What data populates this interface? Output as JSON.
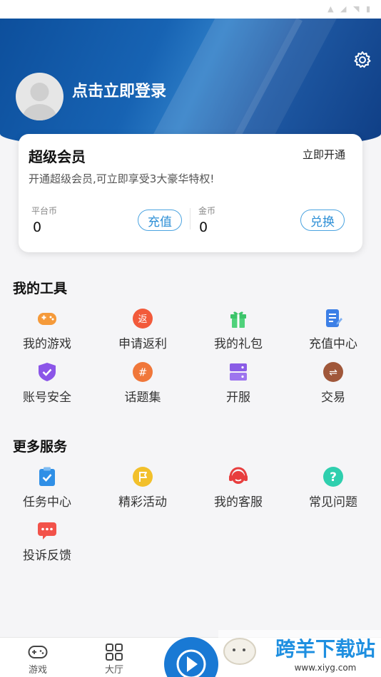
{
  "status_bar": {
    "icons": "▲ ◢ ◥ ▮"
  },
  "header": {
    "login_text": "点击立即登录",
    "settings_icon": "settings-gear-icon",
    "avatar_icon": "default-avatar-icon"
  },
  "vip": {
    "title": "超级会员",
    "open_label": "立即开通",
    "description": "开通超级会员,可立即享受3大豪华特权!",
    "platform_coin_label": "平台币",
    "platform_coin_value": "0",
    "recharge_label": "充值",
    "gold_coin_label": "金币",
    "gold_coin_value": "0",
    "exchange_label": "兑换"
  },
  "tools": {
    "title": "我的工具",
    "items": [
      {
        "label": "我的游戏",
        "icon": "gamepad-icon",
        "color": "#f59a3a"
      },
      {
        "label": "申请返利",
        "icon": "rebate-icon",
        "color": "#f25a3b",
        "glyph": "返"
      },
      {
        "label": "我的礼包",
        "icon": "gift-icon",
        "color": "#3cc46a"
      },
      {
        "label": "充值中心",
        "icon": "recharge-doc-icon",
        "color": "#3c7fe6"
      },
      {
        "label": "账号安全",
        "icon": "shield-icon",
        "color": "#8b55e8"
      },
      {
        "label": "话题集",
        "icon": "topic-hash-icon",
        "color": "#f0773a",
        "glyph": "#"
      },
      {
        "label": "开服",
        "icon": "server-icon",
        "color": "#8a5ce6"
      },
      {
        "label": "交易",
        "icon": "trade-swap-icon",
        "color": "#a0573a",
        "glyph": "⇌"
      }
    ]
  },
  "services": {
    "title": "更多服务",
    "items": [
      {
        "label": "任务中心",
        "icon": "task-clipboard-icon",
        "color": "#2f8fe6"
      },
      {
        "label": "精彩活动",
        "icon": "activity-flag-icon",
        "color": "#f2c02b"
      },
      {
        "label": "我的客服",
        "icon": "customer-service-icon",
        "color": "#e83e3e"
      },
      {
        "label": "常见问题",
        "icon": "faq-question-icon",
        "color": "#2fcfae",
        "glyph": "?"
      },
      {
        "label": "投诉反馈",
        "icon": "feedback-chat-icon",
        "color": "#f2524a"
      }
    ]
  },
  "bottom_nav": {
    "tabs": [
      {
        "label": "游戏",
        "icon": "gamepad-tab-icon"
      },
      {
        "label": "大厅",
        "icon": "grid-tab-icon"
      }
    ],
    "center_icon": "play-fab-icon"
  },
  "watermark": {
    "text": "跨羊下载站",
    "subtext": "www.xiyg.com"
  }
}
